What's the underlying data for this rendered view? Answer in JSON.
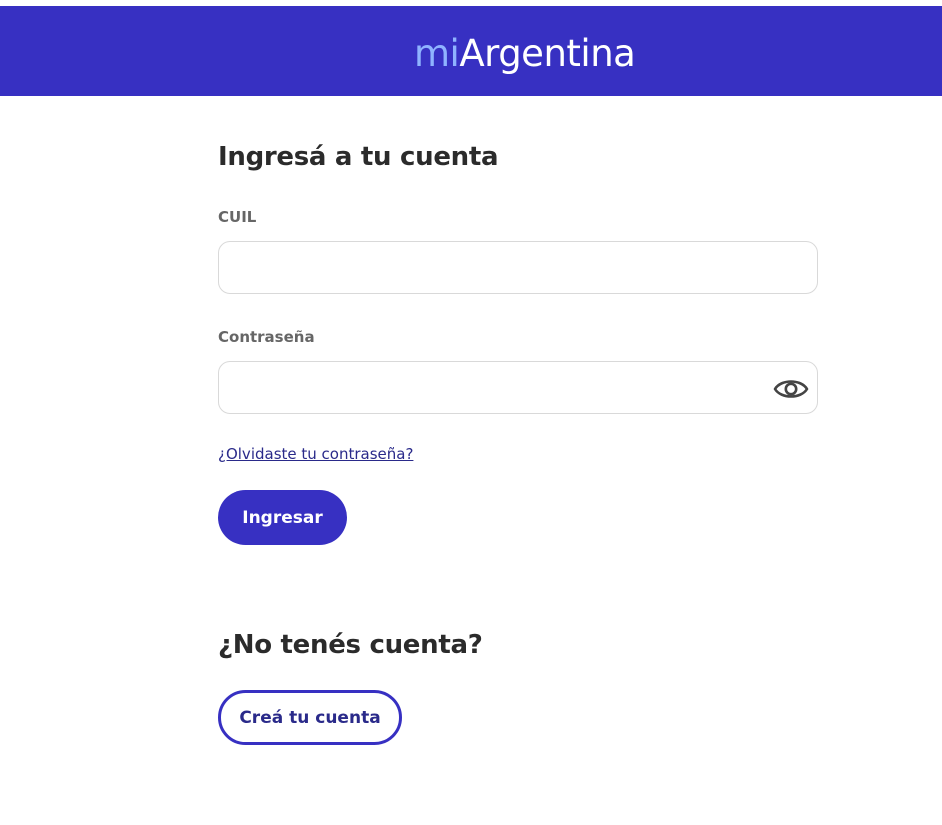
{
  "header": {
    "logo_prefix": "mi",
    "logo_suffix": "Argentina",
    "background_color": "#3730c2",
    "logo_prefix_color": "#8fb3ff"
  },
  "login": {
    "title": "Ingresá a tu cuenta",
    "cuil_label": "CUIL",
    "cuil_value": "",
    "password_label": "Contraseña",
    "password_value": "",
    "show_password_icon": "eye-icon",
    "forgot_link": "¿Olvidaste tu contraseña?",
    "submit_label": "Ingresar"
  },
  "register": {
    "title": "¿No tenés cuenta?",
    "create_label": "Creá tu cuenta"
  }
}
